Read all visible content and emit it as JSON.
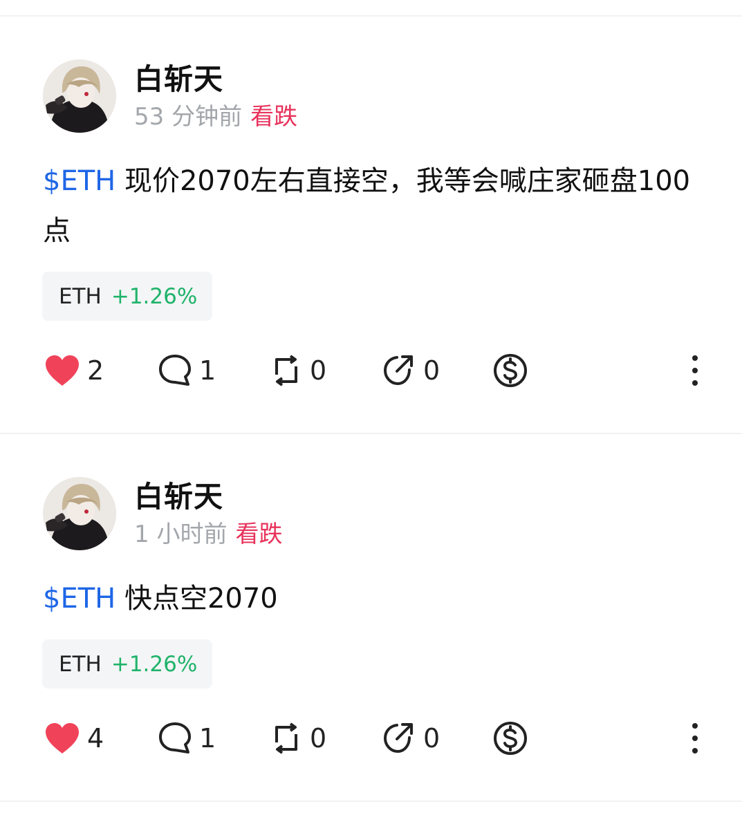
{
  "posts": [
    {
      "username": "白斩天",
      "time": "53 分钟前",
      "sentiment": "看跌",
      "cashtag": "$ETH",
      "text": " 现价2070左右直接空，我等会喊庄家砸盘100点",
      "ticker": {
        "symbol": "ETH",
        "change": "+1.26%"
      },
      "likes": "2",
      "comments": "1",
      "reposts": "0",
      "shares": "0"
    },
    {
      "username": "白斩天",
      "time": "1 小时前",
      "sentiment": "看跌",
      "cashtag": "$ETH",
      "text": " 快点空2070",
      "ticker": {
        "symbol": "ETH",
        "change": "+1.26%"
      },
      "likes": "4",
      "comments": "1",
      "reposts": "0",
      "shares": "0"
    }
  ],
  "colors": {
    "cashtag": "#1e66e6",
    "bearish": "#e8335c",
    "positive_change": "#1fb36a",
    "like_heart": "#f0435a"
  },
  "icons": [
    "heart-icon",
    "comment-icon",
    "repost-icon",
    "share-icon",
    "tip-dollar-icon",
    "more-vertical-icon"
  ]
}
